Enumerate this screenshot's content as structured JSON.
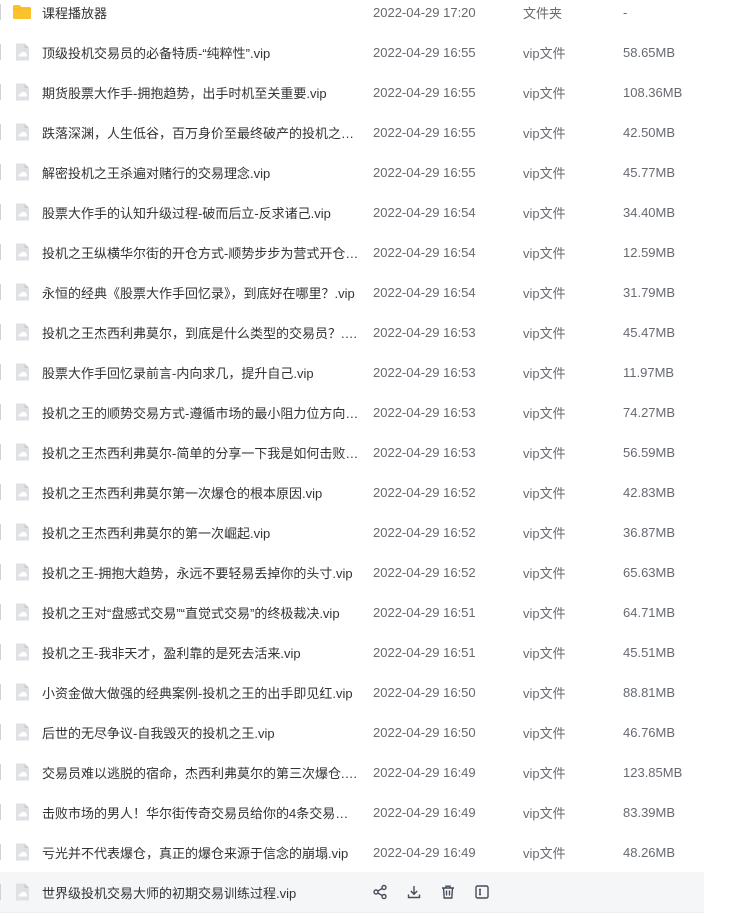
{
  "files": [
    {
      "name": "课程播放器",
      "time": "2022-04-29 17:20",
      "type": "文件夹",
      "size": "-",
      "kind": "folder"
    },
    {
      "name": "顶级投机交易员的必备特质-“纯粹性”.vip",
      "time": "2022-04-29 16:55",
      "type": "vip文件",
      "size": "58.65MB",
      "kind": "file"
    },
    {
      "name": "期货股票大作手-拥抱趋势，出手时机至关重要.vip",
      "time": "2022-04-29 16:55",
      "type": "vip文件",
      "size": "108.36MB",
      "kind": "file"
    },
    {
      "name": "跌落深渊，人生低谷，百万身价至最终破产的投机之王.vip",
      "time": "2022-04-29 16:55",
      "type": "vip文件",
      "size": "42.50MB",
      "kind": "file"
    },
    {
      "name": "解密投机之王杀遍对赌行的交易理念.vip",
      "time": "2022-04-29 16:55",
      "type": "vip文件",
      "size": "45.77MB",
      "kind": "file"
    },
    {
      "name": "股票大作手的认知升级过程-破而后立-反求诸己.vip",
      "time": "2022-04-29 16:54",
      "type": "vip文件",
      "size": "34.40MB",
      "kind": "file"
    },
    {
      "name": "投机之王纵横华尔街的开仓方式-顺势步步为营式开仓.vip",
      "time": "2022-04-29 16:54",
      "type": "vip文件",
      "size": "12.59MB",
      "kind": "file"
    },
    {
      "name": "永恒的经典《股票大作手回忆录》，到底好在哪里？.vip",
      "time": "2022-04-29 16:54",
      "type": "vip文件",
      "size": "31.79MB",
      "kind": "file"
    },
    {
      "name": "投机之王杰西利弗莫尔，到底是什么类型的交易员？.vip",
      "time": "2022-04-29 16:53",
      "type": "vip文件",
      "size": "45.47MB",
      "kind": "file"
    },
    {
      "name": "股票大作手回忆录前言-内向求几，提升自己.vip",
      "time": "2022-04-29 16:53",
      "type": "vip文件",
      "size": "11.97MB",
      "kind": "file"
    },
    {
      "name": "投机之王的顺势交易方式-遵循市场的最小阻力位方向.vip",
      "time": "2022-04-29 16:53",
      "type": "vip文件",
      "size": "74.27MB",
      "kind": "file"
    },
    {
      "name": "投机之王杰西利弗莫尔-简单的分享一下我是如何击败市...",
      "time": "2022-04-29 16:53",
      "type": "vip文件",
      "size": "56.59MB",
      "kind": "file"
    },
    {
      "name": "投机之王杰西利弗莫尔第一次爆仓的根本原因.vip",
      "time": "2022-04-29 16:52",
      "type": "vip文件",
      "size": "42.83MB",
      "kind": "file"
    },
    {
      "name": "投机之王杰西利弗莫尔的第一次崛起.vip",
      "time": "2022-04-29 16:52",
      "type": "vip文件",
      "size": "36.87MB",
      "kind": "file"
    },
    {
      "name": "投机之王-拥抱大趋势，永远不要轻易丢掉你的头寸.vip",
      "time": "2022-04-29 16:52",
      "type": "vip文件",
      "size": "65.63MB",
      "kind": "file"
    },
    {
      "name": "投机之王对“盘感式交易”“直觉式交易”的终极裁决.vip",
      "time": "2022-04-29 16:51",
      "type": "vip文件",
      "size": "64.71MB",
      "kind": "file"
    },
    {
      "name": "投机之王-我非天才，盈利靠的是死去活来.vip",
      "time": "2022-04-29 16:51",
      "type": "vip文件",
      "size": "45.51MB",
      "kind": "file"
    },
    {
      "name": "小资金做大做强的经典案例-投机之王的出手即见红.vip",
      "time": "2022-04-29 16:50",
      "type": "vip文件",
      "size": "88.81MB",
      "kind": "file"
    },
    {
      "name": "后世的无尽争议-自我毁灭的投机之王.vip",
      "time": "2022-04-29 16:50",
      "type": "vip文件",
      "size": "46.76MB",
      "kind": "file"
    },
    {
      "name": "交易员难以逃脱的宿命，杰西利弗莫尔的第三次爆仓.vip",
      "time": "2022-04-29 16:49",
      "type": "vip文件",
      "size": "123.85MB",
      "kind": "file"
    },
    {
      "name": "击败市场的男人！华尔街传奇交易员给你的4条交易忠告.v...",
      "time": "2022-04-29 16:49",
      "type": "vip文件",
      "size": "83.39MB",
      "kind": "file"
    },
    {
      "name": "亏光并不代表爆仓，真正的爆仓来源于信念的崩塌.vip",
      "time": "2022-04-29 16:49",
      "type": "vip文件",
      "size": "48.26MB",
      "kind": "file"
    },
    {
      "name": "世界级投机交易大师的初期交易训练过程.vip",
      "time": "",
      "type": "",
      "size": "",
      "kind": "file",
      "hovered": true
    }
  ],
  "row_actions": [
    "share-icon",
    "download-icon",
    "delete-icon",
    "more-icon"
  ],
  "colors": {
    "folder": "#fbc22b",
    "file_icon_bg": "#dfe1e5",
    "file_icon_fg": "#ffffff",
    "hover_bg": "#f5f6f8",
    "action_icon": "#454d5a"
  }
}
